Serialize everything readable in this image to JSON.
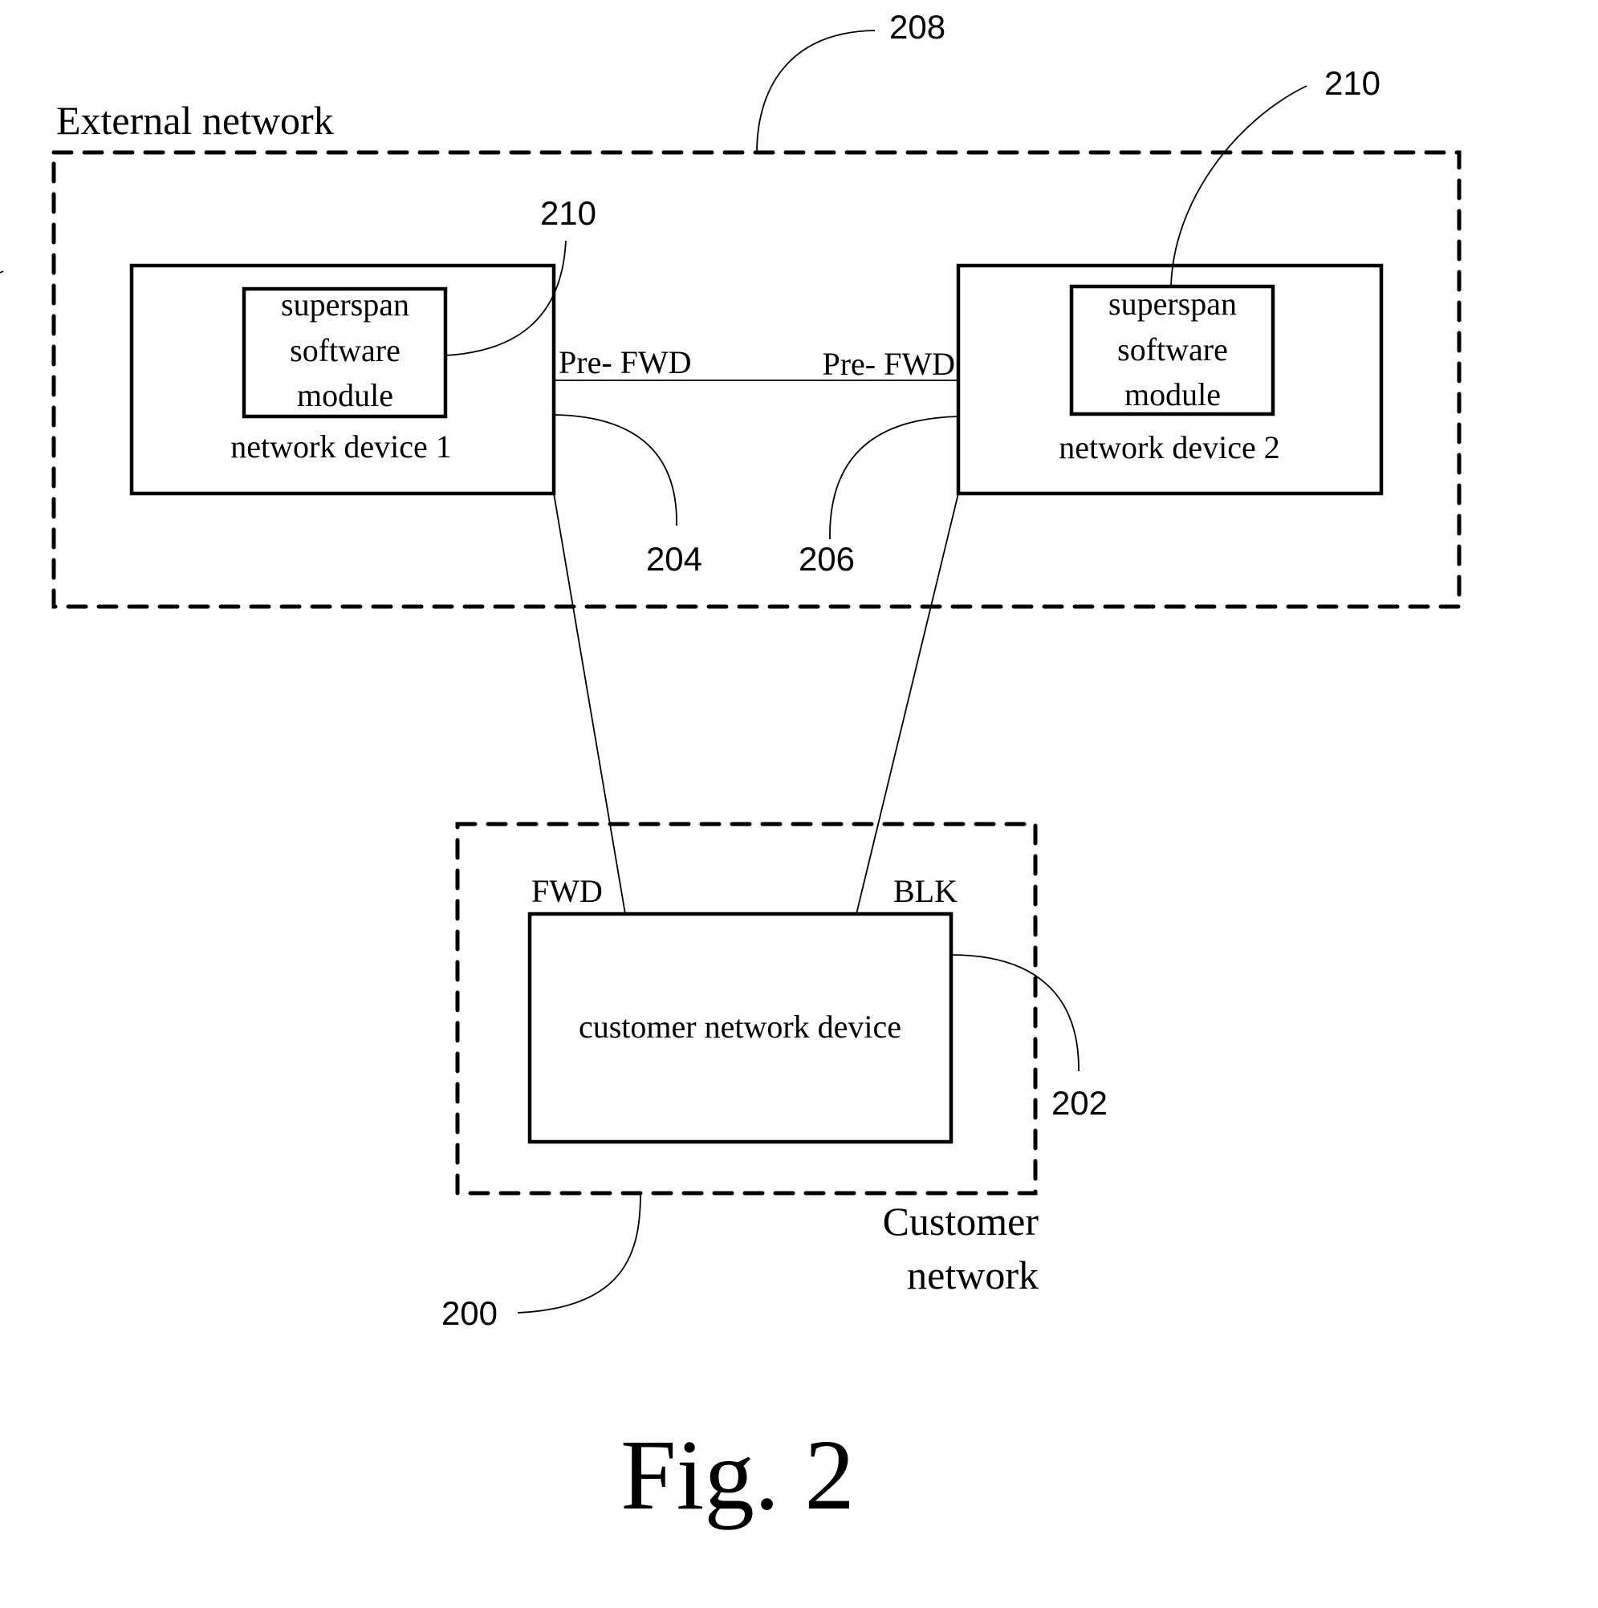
{
  "figure": {
    "caption": "Fig. 2"
  },
  "external_network": {
    "label": "External network",
    "ref": "208"
  },
  "network_device_1": {
    "label": "network device 1",
    "module_lines": [
      "superspan",
      "software",
      "module"
    ],
    "module_ref": "210",
    "port_label": "Pre- FWD",
    "link_ref": "204"
  },
  "network_device_2": {
    "label": "network device 2",
    "module_lines": [
      "superspan",
      "software",
      "module"
    ],
    "module_ref": "210",
    "port_label": "Pre- FWD",
    "link_ref": "206"
  },
  "customer_network": {
    "label_lines": [
      "Customer",
      "network"
    ],
    "ref": "200",
    "device": {
      "label": "customer network device",
      "ref": "202",
      "port_fwd_label": "FWD",
      "port_blk_label": "BLK"
    }
  }
}
